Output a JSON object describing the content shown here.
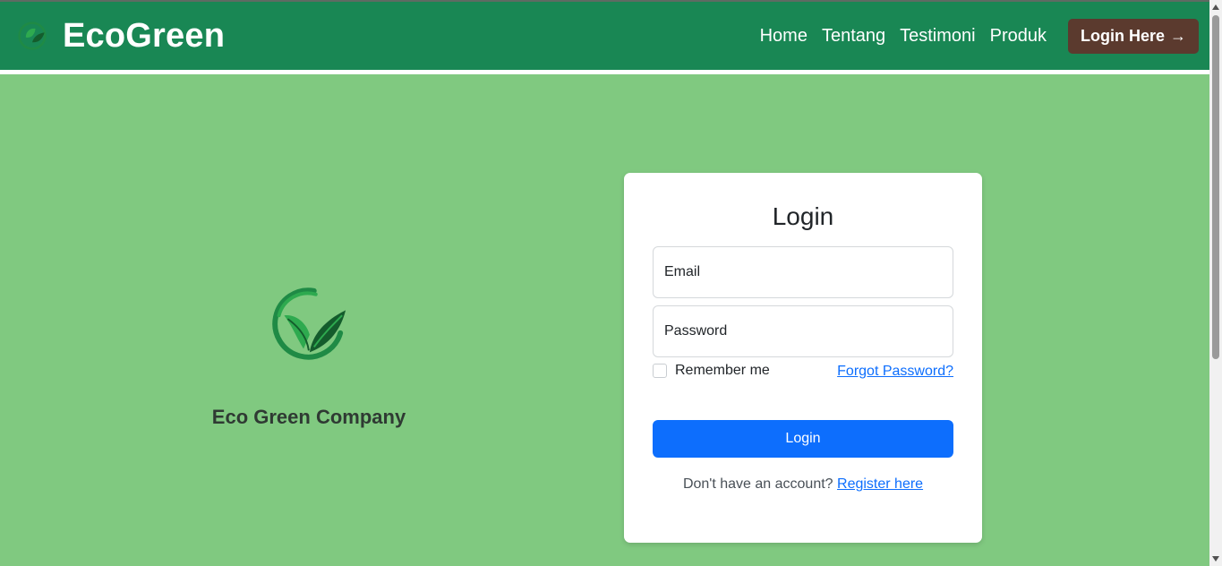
{
  "navbar": {
    "brand": "EcoGreen",
    "links": [
      "Home",
      "Tentang",
      "Testimoni",
      "Produk"
    ],
    "cta_label": "Login Here",
    "cta_arrow": "→"
  },
  "company": {
    "name": "Eco Green Company"
  },
  "login": {
    "title": "Login",
    "email_placeholder": "Email",
    "password_placeholder": "Password",
    "remember_label": "Remember me",
    "forgot_label": "Forgot Password?",
    "submit_label": "Login",
    "register_prompt": "Don't have an account?",
    "register_link": "Register here"
  },
  "colors": {
    "navbar": "#198754",
    "background": "#80c980",
    "cta": "#5b3a2e",
    "primary": "#0d6efd"
  }
}
